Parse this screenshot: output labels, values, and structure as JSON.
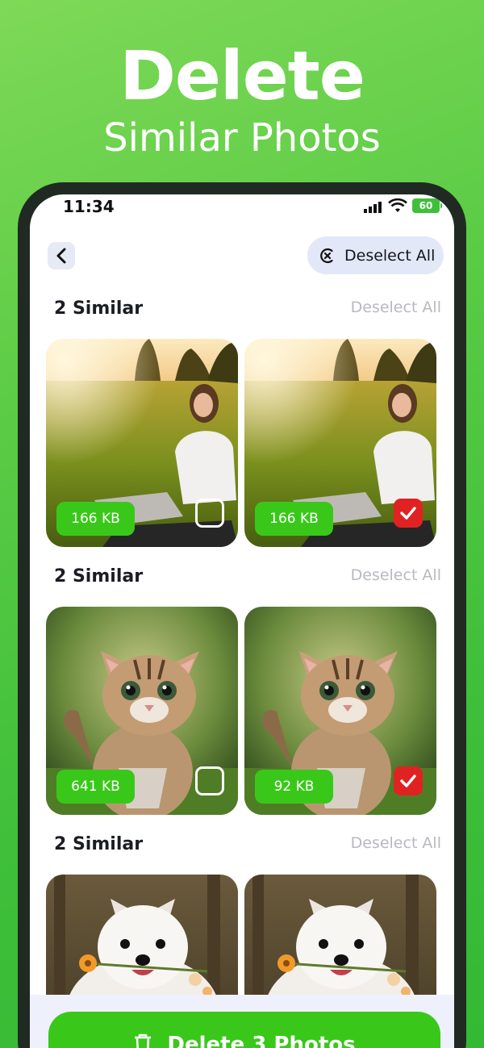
{
  "promo": {
    "title": "Delete",
    "subtitle": "Similar Photos"
  },
  "status_bar": {
    "time": "11:34",
    "battery": "60"
  },
  "header": {
    "back_icon": "chevron-left-icon",
    "deselect_all_label": "Deselect All",
    "deselect_icon": "x-circle-icon"
  },
  "groups": [
    {
      "title": "2 Similar",
      "deselect_label": "Deselect All",
      "photos": [
        {
          "subject": "woman-with-laptop",
          "size": "166 KB",
          "checked": false
        },
        {
          "subject": "woman-with-laptop",
          "size": "166 KB",
          "checked": true
        }
      ]
    },
    {
      "title": "2 Similar",
      "deselect_label": "Deselect All",
      "photos": [
        {
          "subject": "kitten",
          "size": "641 KB",
          "checked": false
        },
        {
          "subject": "kitten",
          "size": "92 KB",
          "checked": true
        }
      ]
    },
    {
      "title": "2 Similar",
      "deselect_label": "Deselect All",
      "photos": [
        {
          "subject": "white-puppy-with-flowers",
          "checked": false
        },
        {
          "subject": "white-puppy-with-flowers",
          "checked": false
        }
      ]
    }
  ],
  "footer": {
    "delete_label": "Delete 3 Photos",
    "delete_icon": "trash-icon"
  },
  "colors": {
    "accent": "#39c81a",
    "checked": "#e02222",
    "background": "#4cc440"
  }
}
